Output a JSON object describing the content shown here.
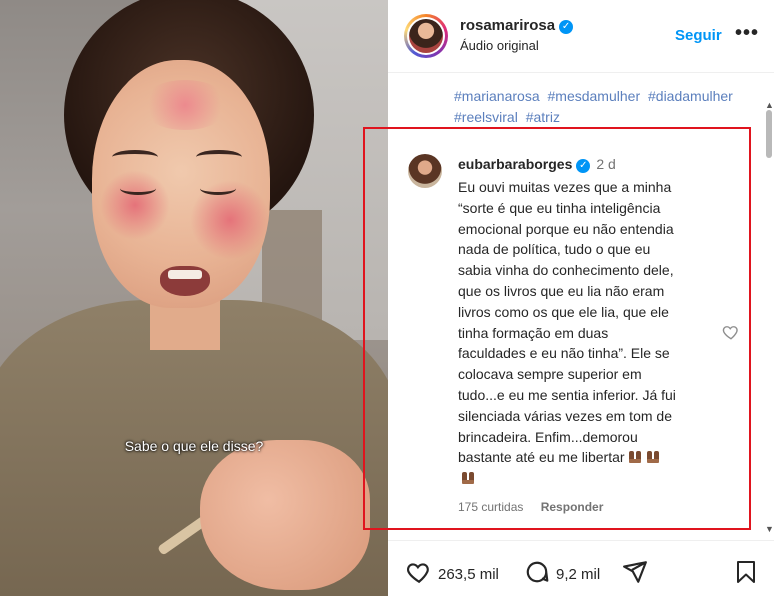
{
  "video": {
    "caption": "Sabe o que ele disse?"
  },
  "header": {
    "username": "rosamarirosa",
    "subtitle": "Áudio original",
    "follow_label": "Seguir",
    "more_label": "•••"
  },
  "hashtags": [
    "#marianarosa",
    "#mesdamulher",
    "#diadamulher",
    "#reelsviral",
    "#atriz"
  ],
  "comment": {
    "username": "eubarbaraborges",
    "time": "2 d",
    "lines": [
      "Eu ouvi muitas vezes que a minha",
      "“sorte é que eu tinha inteligência",
      "emocional porque eu não entendia",
      "nada de política, tudo o que eu",
      "sabia vinha do conhecimento dele,",
      "que os livros que eu lia não eram",
      "livros como os que ele lia, que ele",
      "tinha formação em duas",
      "faculdades e eu não tinha”. Ele se",
      "colocava sempre superior em",
      "tudo...e eu me sentia inferior. Já fui",
      "silenciada várias vezes em tom de",
      "brincadeira. Enfim...demorou",
      "bastante até eu me libertar"
    ],
    "likes": "175 curtidas",
    "reply_label": "Responder"
  },
  "actions": {
    "likes": "263,5 mil",
    "comments": "9,2 mil"
  },
  "colors": {
    "accent": "#0095f6",
    "highlight": "#e0141e"
  },
  "icons": [
    "heart-icon",
    "comment-icon",
    "share-icon",
    "bookmark-icon",
    "verified-icon",
    "more-icon"
  ]
}
